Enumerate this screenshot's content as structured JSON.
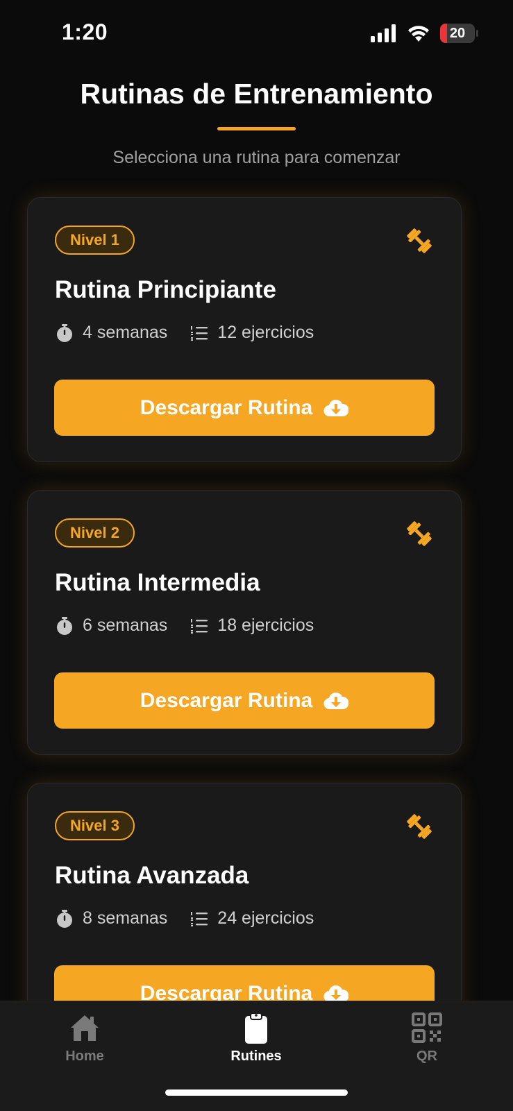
{
  "status_bar": {
    "time": "1:20",
    "battery_level": "20",
    "battery_fraction": 0.2,
    "icons": [
      "cellular-signal-icon",
      "wifi-icon",
      "battery-icon"
    ]
  },
  "header": {
    "title": "Rutinas de Entrenamiento",
    "subtitle": "Selecciona una rutina para comenzar"
  },
  "colors": {
    "accent": "#f5a623",
    "background": "#0b0b0b",
    "card": "#1a1a1a",
    "battery_low": "#e8353a"
  },
  "routines": [
    {
      "level": "Nivel 1",
      "title": "Rutina Principiante",
      "duration": "4 semanas",
      "exercises": "12 ejercicios",
      "button_label": "Descargar Rutina"
    },
    {
      "level": "Nivel 2",
      "title": "Rutina Intermedia",
      "duration": "6 semanas",
      "exercises": "18 ejercicios",
      "button_label": "Descargar Rutina"
    },
    {
      "level": "Nivel 3",
      "title": "Rutina Avanzada",
      "duration": "8 semanas",
      "exercises": "24 ejercicios",
      "button_label": "Descargar Rutina"
    }
  ],
  "tab_bar": {
    "active": "Rutines",
    "tabs": [
      {
        "label": "Home",
        "icon": "home-icon"
      },
      {
        "label": "Rutines",
        "icon": "clipboard-icon"
      },
      {
        "label": "QR",
        "icon": "qr-code-icon"
      }
    ]
  }
}
